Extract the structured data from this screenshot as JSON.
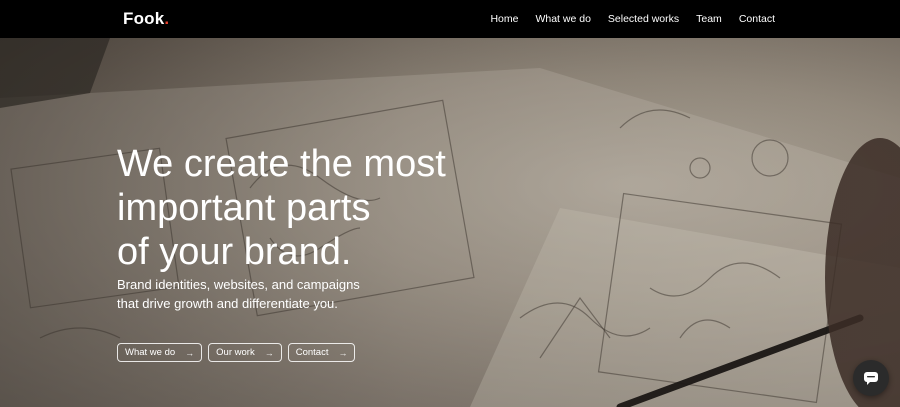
{
  "brand": {
    "name": "Fook",
    "dot": "."
  },
  "nav": {
    "items": [
      {
        "label": "Home"
      },
      {
        "label": "What we do"
      },
      {
        "label": "Selected works"
      },
      {
        "label": "Team"
      },
      {
        "label": "Contact"
      }
    ]
  },
  "hero": {
    "title_lines": [
      "We create the most",
      "important parts",
      "of your brand."
    ],
    "subtitle_lines": [
      "Brand identities, websites, and campaigns",
      "that drive growth and differentiate you."
    ],
    "buttons": [
      {
        "label": "What we do",
        "icon": "arrow-right-icon"
      },
      {
        "label": "Our work",
        "icon": "arrow-right-icon"
      },
      {
        "label": "Contact",
        "icon": "arrow-right-icon"
      }
    ],
    "arrow_glyph": "→"
  },
  "chat": {
    "icon": "chat-bubble-icon"
  },
  "colors": {
    "navbar_bg": "#000000",
    "logo_dot": "#e8412c",
    "text": "#ffffff",
    "chat_bg": "#2b2b2b"
  }
}
